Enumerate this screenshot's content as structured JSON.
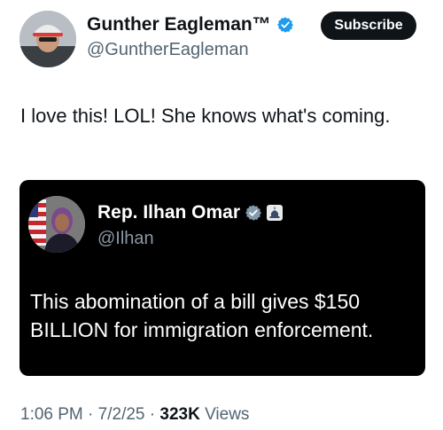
{
  "author": {
    "display_name": "Gunther Eagleman™",
    "handle": "@GuntherEagleman",
    "avatar_icon": "profile-photo",
    "verified_icon": "verified-badge-icon",
    "verified_color": "#1d9bf0"
  },
  "subscribe_button": {
    "label": "Subscribe"
  },
  "tweet": {
    "text": "I love this!  LOL!  She knows what's coming."
  },
  "quoted_post": {
    "display_name": "Rep. Ilhan Omar",
    "handle": "@Ilhan",
    "verified_icon": "verified-badge-grey-icon",
    "affiliation_icon": "capitol-building-icon",
    "text": "This abomination of a bill gives $150 BILLION for immigration enforcement."
  },
  "meta": {
    "time": "1:06 PM",
    "separator": "·",
    "date": "7/2/25",
    "views_count": "323K",
    "views_label": "Views"
  },
  "colors": {
    "text_primary": "#0f1419",
    "text_secondary": "#536471",
    "embed_background": "#000000"
  }
}
